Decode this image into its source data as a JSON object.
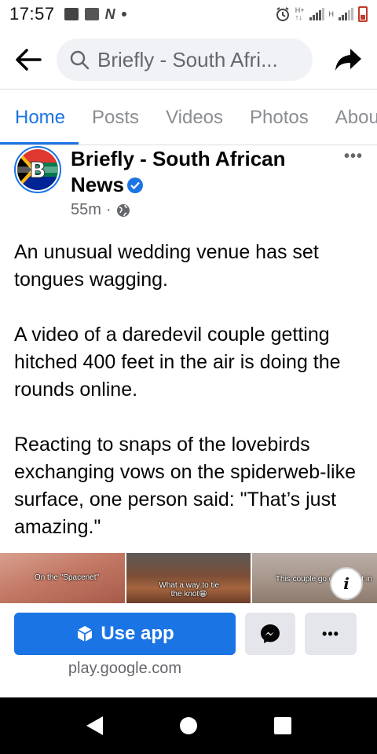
{
  "status_bar": {
    "time": "17:57",
    "net_small_top": "H+",
    "net_small_bottom": "↑↓",
    "net_small_2": "H"
  },
  "top_bar": {
    "search_text": "Briefly - South Afri..."
  },
  "tabs": [
    {
      "label": "Home"
    },
    {
      "label": "Posts"
    },
    {
      "label": "Videos"
    },
    {
      "label": "Photos"
    },
    {
      "label": "Abou"
    }
  ],
  "post": {
    "page_name": "Briefly - South African News",
    "time_ago": "55m",
    "separator": "·",
    "paragraphs": [
      "An unusual wedding venue has set tongues wagging.",
      "A video of a daredevil couple getting hitched 400 feet in the air is doing the rounds online.",
      "Reacting to snaps of the lovebirds exchanging vows on the spiderweb-like surface, one person said: \"That’s just amazing.\""
    ],
    "more_label": "•••"
  },
  "media": {
    "captions": [
      "On the \"Spacenet\"",
      "What a way to tie the knot😁",
      "This couple go        d 400 feet in"
    ],
    "info_label": "i"
  },
  "app_banner": {
    "use_app_label": "Use app",
    "more_label": "•••",
    "store_url": "play.google.com"
  },
  "colors": {
    "accent": "#1b74e4",
    "secondary_text": "#65676b"
  }
}
